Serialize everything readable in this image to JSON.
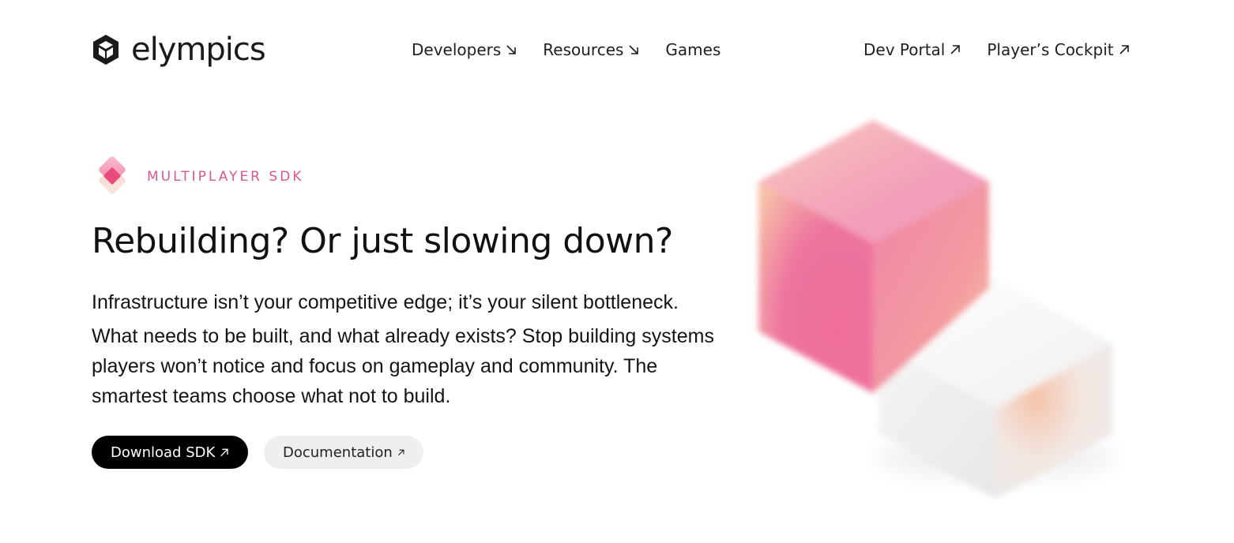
{
  "header": {
    "logo_text": "elympics",
    "nav_center": [
      {
        "label": "Developers",
        "icon": "arrow-down-right-icon"
      },
      {
        "label": "Resources",
        "icon": "arrow-down-right-icon"
      },
      {
        "label": "Games",
        "icon": ""
      }
    ],
    "nav_right": [
      {
        "label": "Dev Portal",
        "icon": "arrow-up-right-icon"
      },
      {
        "label": "Player’s Cockpit",
        "icon": "arrow-up-right-icon"
      }
    ]
  },
  "hero": {
    "badge": "MULTIPLAYER SDK",
    "headline": "Rebuilding? Or just slowing down?",
    "lead": "Infrastructure isn’t your competitive edge; it’s your silent bottleneck.",
    "body": "What needs to be built, and what already exists? Stop building systems players won’t notice and focus on gameplay and community. The smartest teams choose what not to build.",
    "primary_button": "Download SDK",
    "secondary_button": "Documentation"
  },
  "colors": {
    "accent": "#d9598a",
    "primary_button_bg": "#000000",
    "secondary_button_bg": "#efefef"
  }
}
